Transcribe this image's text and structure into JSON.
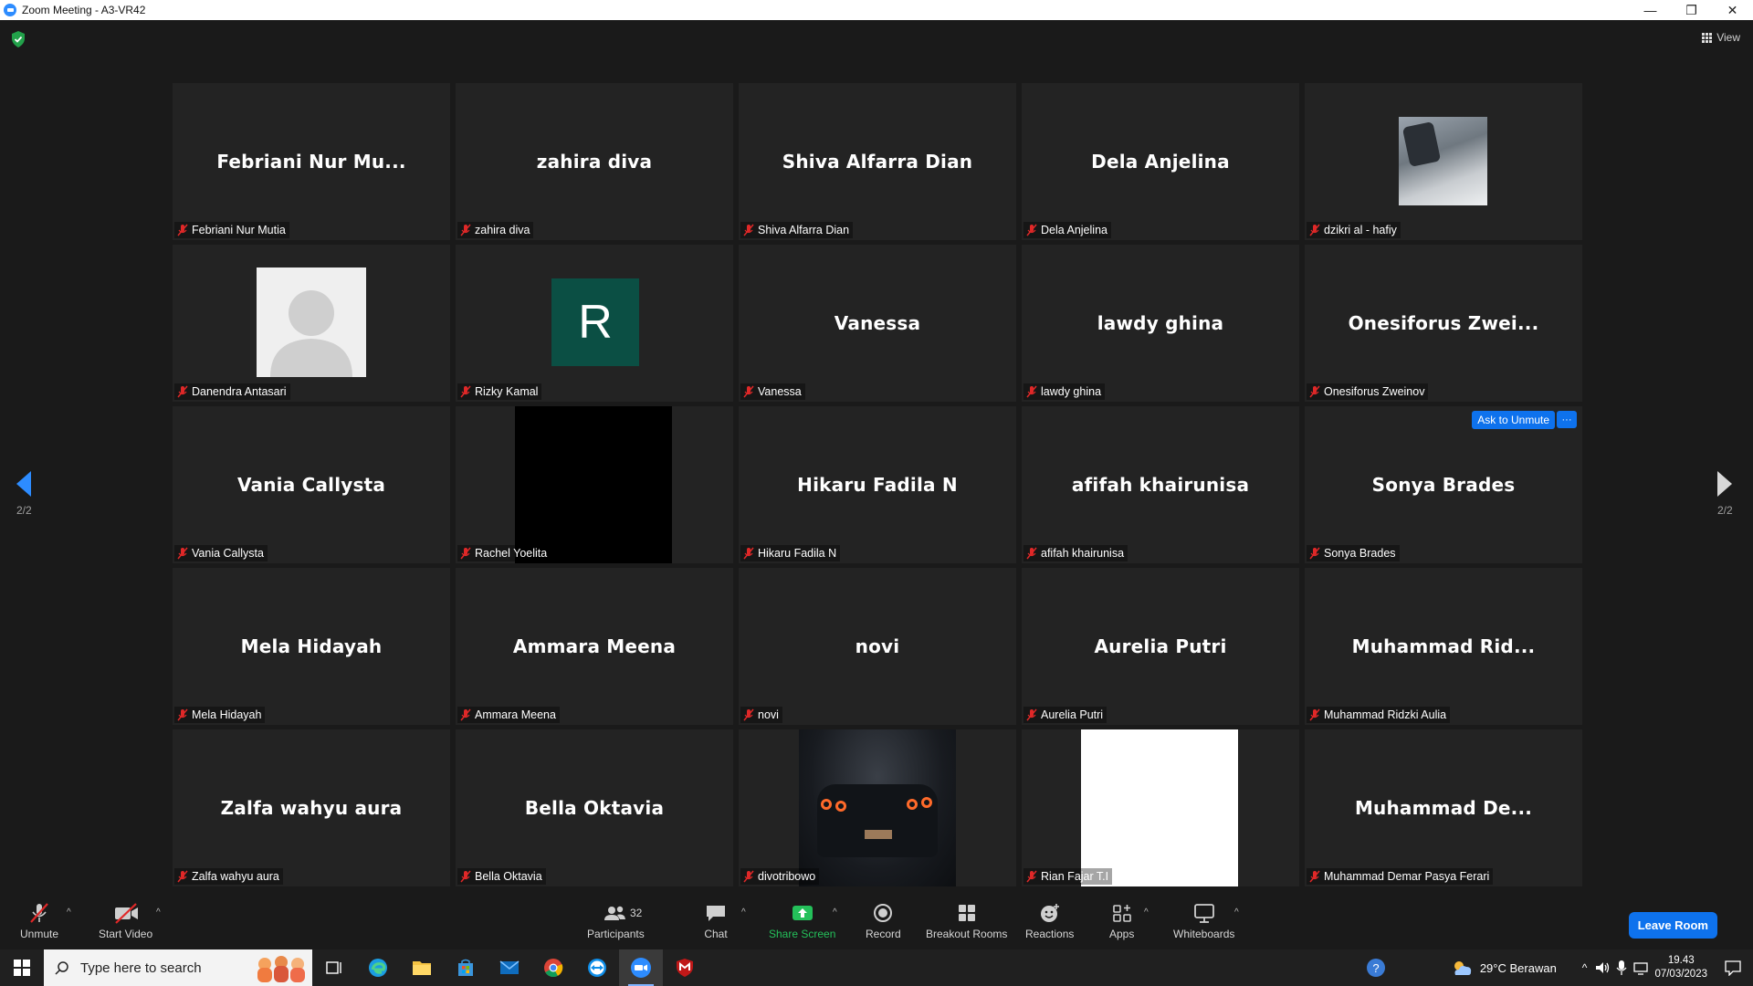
{
  "window": {
    "title": "Zoom Meeting - A3-VR42",
    "minimize": "—",
    "restore": "❐",
    "close": "✕"
  },
  "top": {
    "view_label": "View"
  },
  "pager": {
    "left_page": "2/2",
    "right_page": "2/2"
  },
  "tiles": [
    {
      "display": "Febriani  Nur  Mu...",
      "name": "Febriani Nur Mutia"
    },
    {
      "display": "zahira diva",
      "name": "zahira diva"
    },
    {
      "display": "Shiva Alfarra Dian",
      "name": "Shiva Alfarra Dian"
    },
    {
      "display": "Dela Anjelina",
      "name": "Dela Anjelina"
    },
    {
      "display": "",
      "name": "dzikri al - hafiy"
    },
    {
      "display": "",
      "name": "Danendra Antasari"
    },
    {
      "display": "R",
      "name": "Rizky Kamal"
    },
    {
      "display": "Vanessa",
      "name": "Vanessa"
    },
    {
      "display": "lawdy ghina",
      "name": "lawdy ghina"
    },
    {
      "display": "Onesiforus  Zwei...",
      "name": "Onesiforus Zweinov"
    },
    {
      "display": "Vania Callysta",
      "name": "Vania Callysta"
    },
    {
      "display": "",
      "name": "Rachel Yoelita"
    },
    {
      "display": "Hikaru Fadila N",
      "name": "Hikaru Fadila N"
    },
    {
      "display": "afifah khairunisa",
      "name": "afifah khairunisa"
    },
    {
      "display": "Sonya Brades",
      "name": "Sonya Brades"
    },
    {
      "display": "Mela Hidayah",
      "name": "Mela Hidayah"
    },
    {
      "display": "Ammara Meena",
      "name": "Ammara Meena"
    },
    {
      "display": "novi",
      "name": "novi"
    },
    {
      "display": "Aurelia Putri",
      "name": "Aurelia Putri"
    },
    {
      "display": "Muhammad  Rid...",
      "name": "Muhammad Ridzki Aulia"
    },
    {
      "display": "Zalfa wahyu aura",
      "name": "Zalfa wahyu aura"
    },
    {
      "display": "Bella Oktavia",
      "name": "Bella Oktavia"
    },
    {
      "display": "",
      "name": "divotribowo"
    },
    {
      "display": "",
      "name": "Rian Fajar T.I"
    },
    {
      "display": "Muhammad  De...",
      "name": "Muhammad Demar Pasya Ferari"
    }
  ],
  "hover_actions": {
    "ask_to_unmute": "Ask to Unmute",
    "more": "···"
  },
  "toolbar": {
    "unmute": "Unmute",
    "start_video": "Start Video",
    "participants": "Participants",
    "participants_count": "32",
    "chat": "Chat",
    "share_screen": "Share Screen",
    "record": "Record",
    "breakout_rooms": "Breakout Rooms",
    "reactions": "Reactions",
    "apps": "Apps",
    "whiteboards": "Whiteboards",
    "leave": "Leave Room",
    "caret": "^"
  },
  "taskbar": {
    "search_placeholder": "Type here to search",
    "weather": "29°C  Berawan",
    "time": "19.43",
    "date": "07/03/2023",
    "caret": "^"
  },
  "colors": {
    "accent": "#0e72ed",
    "share_green": "#24c05a",
    "mute_red": "#e02828",
    "tile_bg": "#232323",
    "avatar_green": "#0b4f44"
  }
}
